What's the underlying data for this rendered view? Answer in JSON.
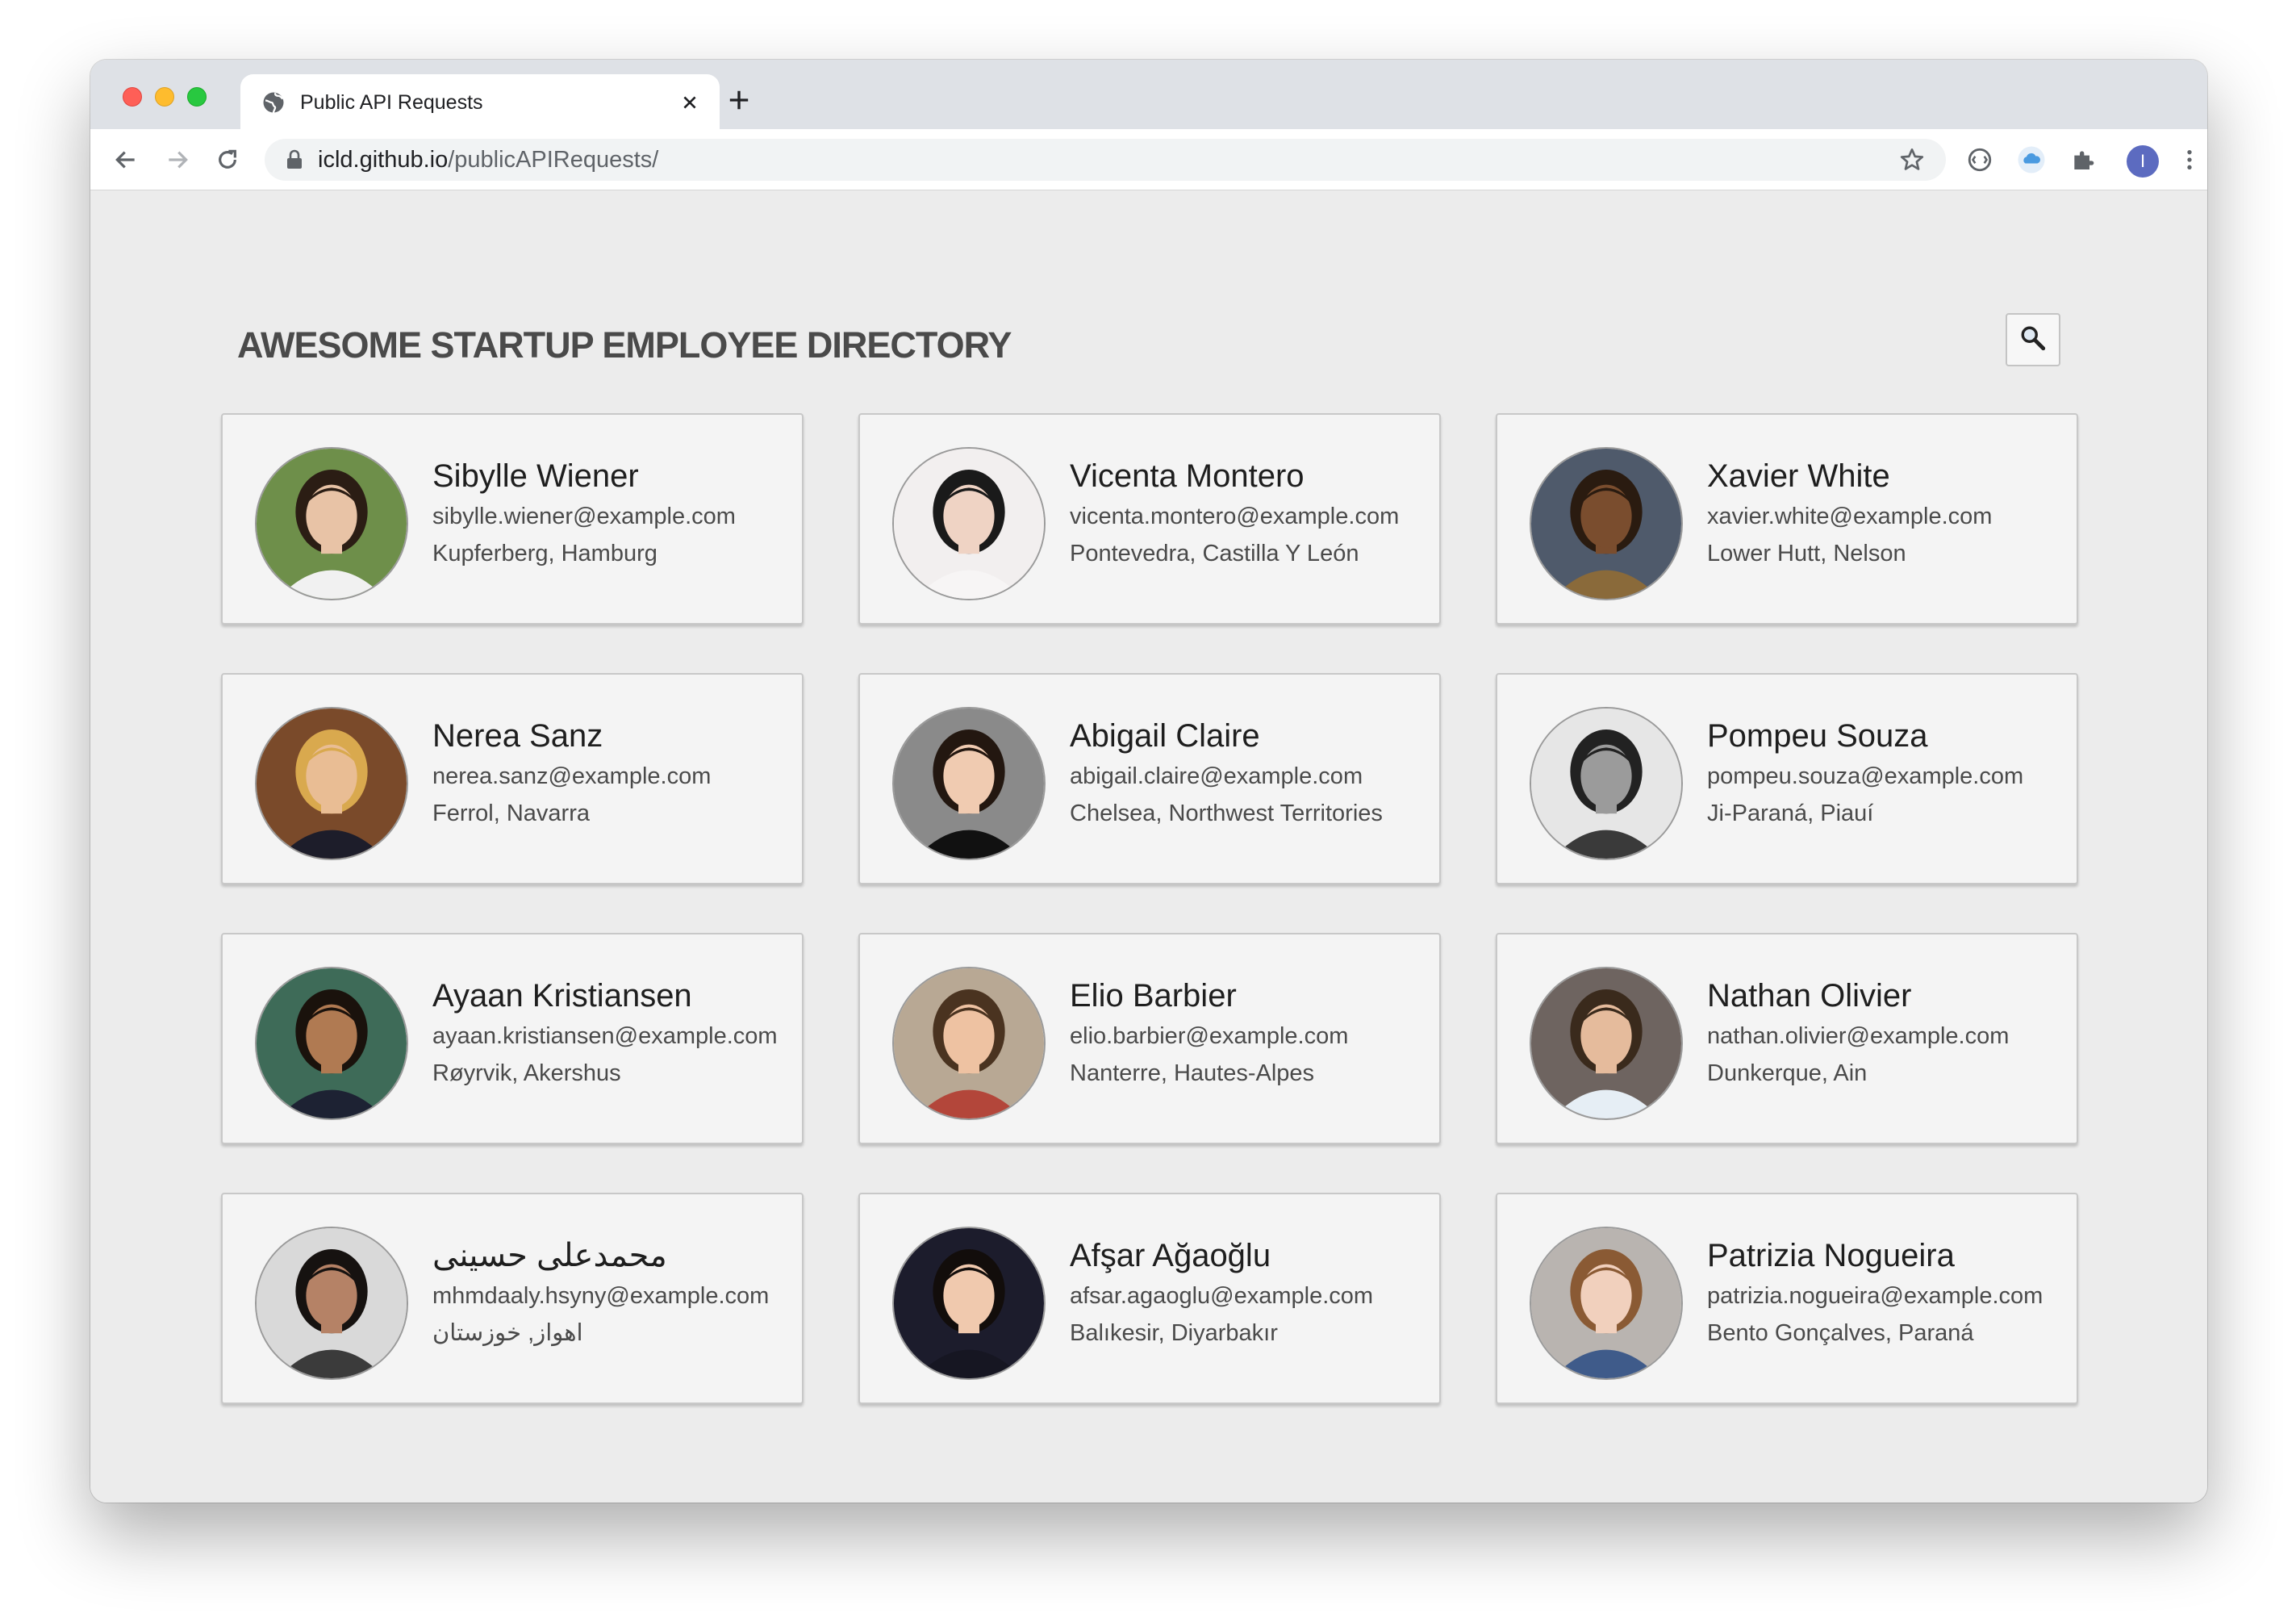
{
  "browser": {
    "tab_title": "Public API Requests",
    "url_host": "icld.github.io",
    "url_path": "/publicAPIRequests/",
    "profile_initial": "I"
  },
  "page": {
    "title": "AWESOME STARTUP EMPLOYEE DIRECTORY"
  },
  "employees": [
    {
      "name": "Sibylle Wiener",
      "email": "sibylle.wiener@example.com",
      "location": "Kupferberg, Hamburg"
    },
    {
      "name": "Vicenta Montero",
      "email": "vicenta.montero@example.com",
      "location": "Pontevedra, Castilla Y León"
    },
    {
      "name": "Xavier White",
      "email": "xavier.white@example.com",
      "location": "Lower Hutt, Nelson"
    },
    {
      "name": "Nerea Sanz",
      "email": "nerea.sanz@example.com",
      "location": "Ferrol, Navarra"
    },
    {
      "name": "Abigail Claire",
      "email": "abigail.claire@example.com",
      "location": "Chelsea, Northwest Territories"
    },
    {
      "name": "Pompeu Souza",
      "email": "pompeu.souza@example.com",
      "location": "Ji-Paraná, Piauí"
    },
    {
      "name": "Ayaan Kristiansen",
      "email": "ayaan.kristiansen@example.com",
      "location": "Røyrvik, Akershus"
    },
    {
      "name": "Elio Barbier",
      "email": "elio.barbier@example.com",
      "location": "Nanterre, Hautes-Alpes"
    },
    {
      "name": "Nathan Olivier",
      "email": "nathan.olivier@example.com",
      "location": "Dunkerque, Ain"
    },
    {
      "name": "محمدعلی حسینی",
      "email": "mhmdaaly.hsyny@example.com",
      "location": "اهواز, خوزستان"
    },
    {
      "name": "Afşar Ağaoğlu",
      "email": "afsar.agaoglu@example.com",
      "location": "Balıkesir, Diyarbakır"
    },
    {
      "name": "Patrizia Nogueira",
      "email": "patrizia.nogueira@example.com",
      "location": "Bento Gonçalves, Paraná"
    }
  ],
  "avatars": [
    {
      "bg": "#6e8f4a",
      "skin": "#e8c3a6",
      "hair": "#2b1d14",
      "shirt": "#f1f1f1"
    },
    {
      "bg": "#f2efef",
      "skin": "#efd3c4",
      "hair": "#1a1a1a",
      "shirt": "#f7f5f5"
    },
    {
      "bg": "#4f5a6b",
      "skin": "#7a4d2e",
      "hair": "#2a1b10",
      "shirt": "#8a6a3a"
    },
    {
      "bg": "#7a4a2a",
      "skin": "#e9bd94",
      "hair": "#d9a94e",
      "shirt": "#1d1d2a"
    },
    {
      "bg": "#8a8a8a",
      "skin": "#f0cbb1",
      "hair": "#231710",
      "shirt": "#111111"
    },
    {
      "bg": "#e6e6e6",
      "skin": "#9b9b9b",
      "hair": "#222222",
      "shirt": "#3a3a3a"
    },
    {
      "bg": "#3e6b58",
      "skin": "#b07a52",
      "hair": "#1a120c",
      "shirt": "#1d2233"
    },
    {
      "bg": "#b8a894",
      "skin": "#eec2a2",
      "hair": "#4a3320",
      "shirt": "#b3463a"
    },
    {
      "bg": "#6e6460",
      "skin": "#e5bb9c",
      "hair": "#3a2a1c",
      "shirt": "#e6eef5"
    },
    {
      "bg": "#d9d9d9",
      "skin": "#b58266",
      "hair": "#161210",
      "shirt": "#3b3b3b"
    },
    {
      "bg": "#1c1c2c",
      "skin": "#f0c9ae",
      "hair": "#120d0b",
      "shirt": "#161622"
    },
    {
      "bg": "#b9b4b0",
      "skin": "#f1d0bd",
      "hair": "#8a5a34",
      "shirt": "#3f5b8a"
    }
  ]
}
